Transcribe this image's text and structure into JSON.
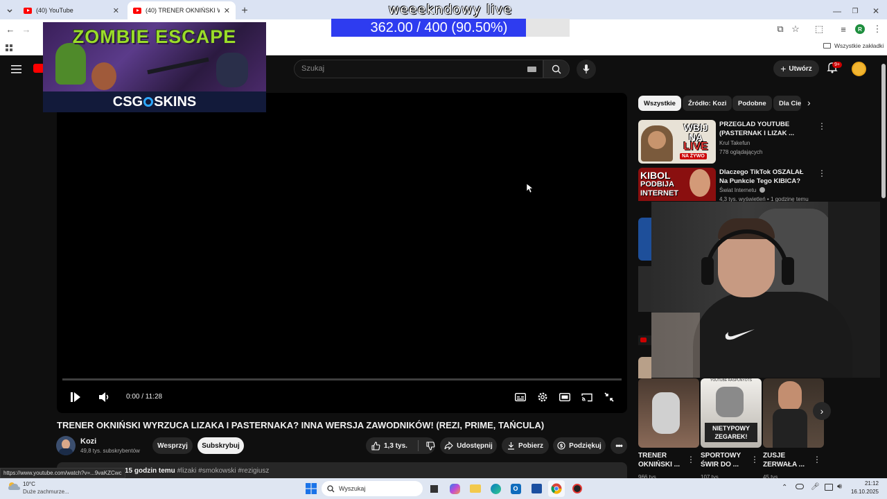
{
  "browser": {
    "tabs": [
      {
        "title": "(40) YouTube",
        "active": false
      },
      {
        "title": "(40) TRENER OKNIŃSKI WYRZU",
        "active": true
      }
    ],
    "bookmarks_folder": "Wszystkie zakładki",
    "profile_initial": "R"
  },
  "stream_overlay": {
    "title": "weeekndowy live",
    "goal_text": "362.00 / 400 (90.50%)",
    "goal_progress": 0.905,
    "ad_title": "ZOMBIE ESCAPE",
    "ad_brand_left": "CSG",
    "ad_brand_right": "SKINS"
  },
  "youtube": {
    "search_placeholder": "Szukaj",
    "create_label": "Utwórz",
    "notifications_badge": "9+",
    "player": {
      "time": "0:00 / 11:28",
      "progress": 0
    },
    "video_title": "TRENER OKNIŃSKI WYRZUCA LIZAKA I PASTERNAKA? INNA WERSJA ZAWODNIKÓW! (REZI, PRIME, TAŃCULA)",
    "channel": {
      "name": "Kozi",
      "subs": "49,8 tys. subskrybentów"
    },
    "buttons": {
      "support": "Wesprzyj",
      "subscribe": "Subskrybuj",
      "likes": "1,3 tys.",
      "share": "Udostępnij",
      "download": "Pobierz",
      "thanks": "Podziękuj"
    },
    "description": {
      "time": "15 godzin temu",
      "tags": "#lizaki #smokowski #rezigiusz"
    },
    "status_url": "https://www.youtube.com/watch?v=...9vaKZCwc",
    "chips": [
      "Wszystkie",
      "Źródło: Kozi",
      "Podobne",
      "Dla Cie"
    ],
    "recommendations": [
      {
        "title": "PRZEGLAD YOUTUBE (PASTERNAK I LIZAK ...",
        "channel": "Krul Takefun",
        "meta": "778 oglądających",
        "thumb_text_1": "WBIJ",
        "thumb_text_2": "NA",
        "thumb_text_3": "LIVE",
        "thumb_badge": "NA ŻYWO"
      },
      {
        "title": "Dlaczego TikTok OSZALAŁ Na Punkcie Tego KIBICA?",
        "channel": "Świat Internetu",
        "meta": "4,3 tys. wyświetleń • 1 godzinę temu",
        "thumb_text_1": "KIBOL",
        "thumb_text_2": "PODBIJA",
        "thumb_text_3": "INTERNET"
      }
    ],
    "shorts": [
      {
        "title": "TRENER OKNIŃSKI ...",
        "meta": "966 tys."
      },
      {
        "title": "SPORTOWY ŚWIR DO ...",
        "meta": "107 tys.",
        "thumb_text_top": "YOUTUBE RASPUNYOTS",
        "thumb_text": "NIETYPOWY ZEGAREK!"
      },
      {
        "title": "ZUSJE ZERWAŁA ...",
        "meta": "45 tys."
      }
    ]
  },
  "taskbar": {
    "weather_temp": "10°C",
    "weather_desc": "Duże zachmurze...",
    "search": "Wyszukaj",
    "time": "21:12",
    "date": "16.10.2025"
  }
}
